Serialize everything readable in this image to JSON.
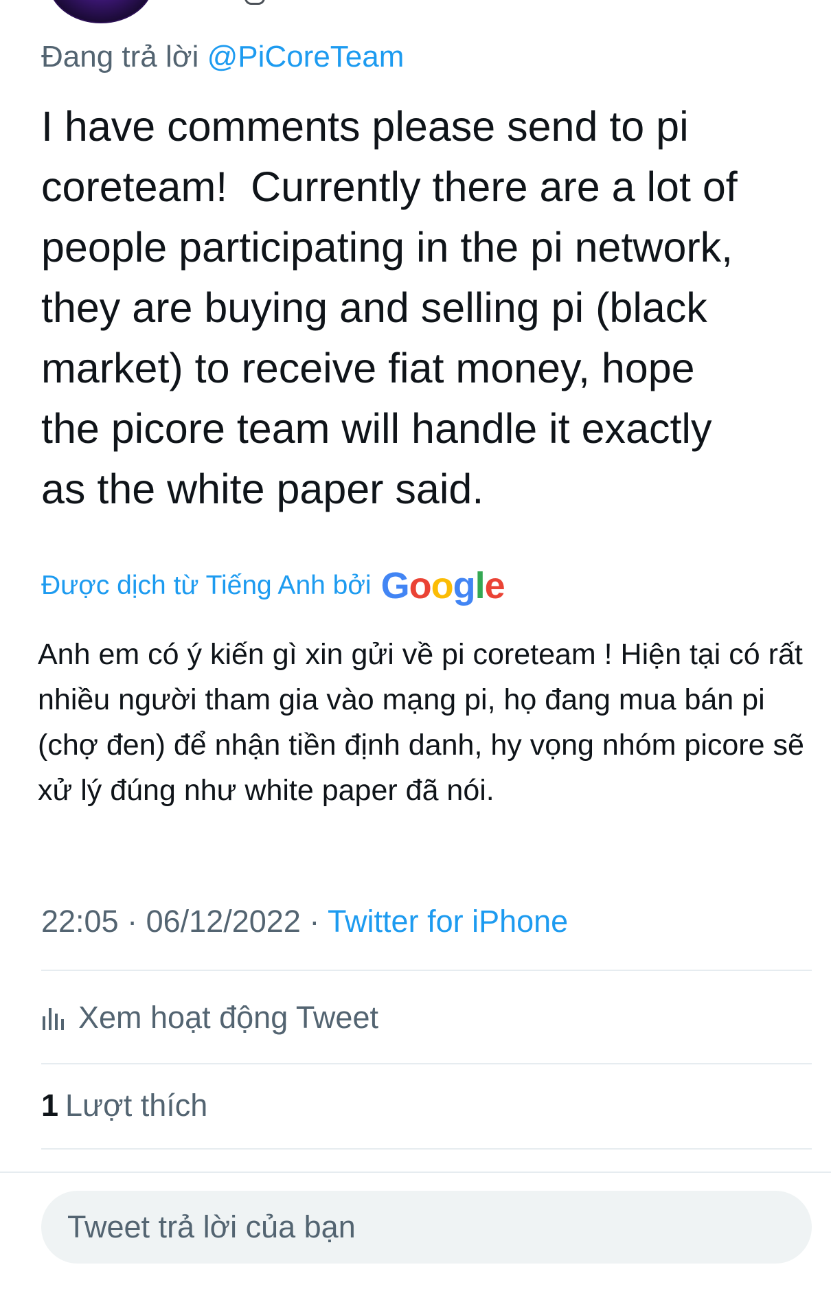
{
  "reply_context": {
    "prefix": "Đang trả lời",
    "handle": "@PiCoreTeam"
  },
  "tweet": {
    "text": "I have comments please send to pi\ncoreteam!  Currently there are a lot of\npeople participating in the pi network,\nthey are buying and selling pi (black\nmarket) to receive fiat money, hope\nthe picore team will handle it exactly\nas the white paper said."
  },
  "translation": {
    "label": "Được dịch từ Tiếng Anh bởi",
    "provider": "Google",
    "text": "Anh em có ý kiến gì xin gửi về pi coreteam ! Hiện tại có rất nhiều người tham gia vào mạng pi, họ đang mua bán pi (chợ đen) để nhận tiền định danh, hy vọng nhóm picore sẽ xử lý đúng như white paper đã nói."
  },
  "meta": {
    "time": "22:05",
    "separator1": " · ",
    "date": "06/12/2022",
    "separator2": " · ",
    "source": "Twitter for iPhone"
  },
  "activity": {
    "icon": "analytics-icon",
    "label": "Xem hoạt động Tweet"
  },
  "likes": {
    "count": "1",
    "label": "Lượt thích"
  },
  "reply_input": {
    "placeholder": "Tweet trả lời của bạn"
  },
  "colors": {
    "accent": "#1d9bf0",
    "text_primary": "#0f1419",
    "text_secondary": "#536471",
    "divider": "#e6ecf0",
    "input_bg": "#eff3f4"
  }
}
